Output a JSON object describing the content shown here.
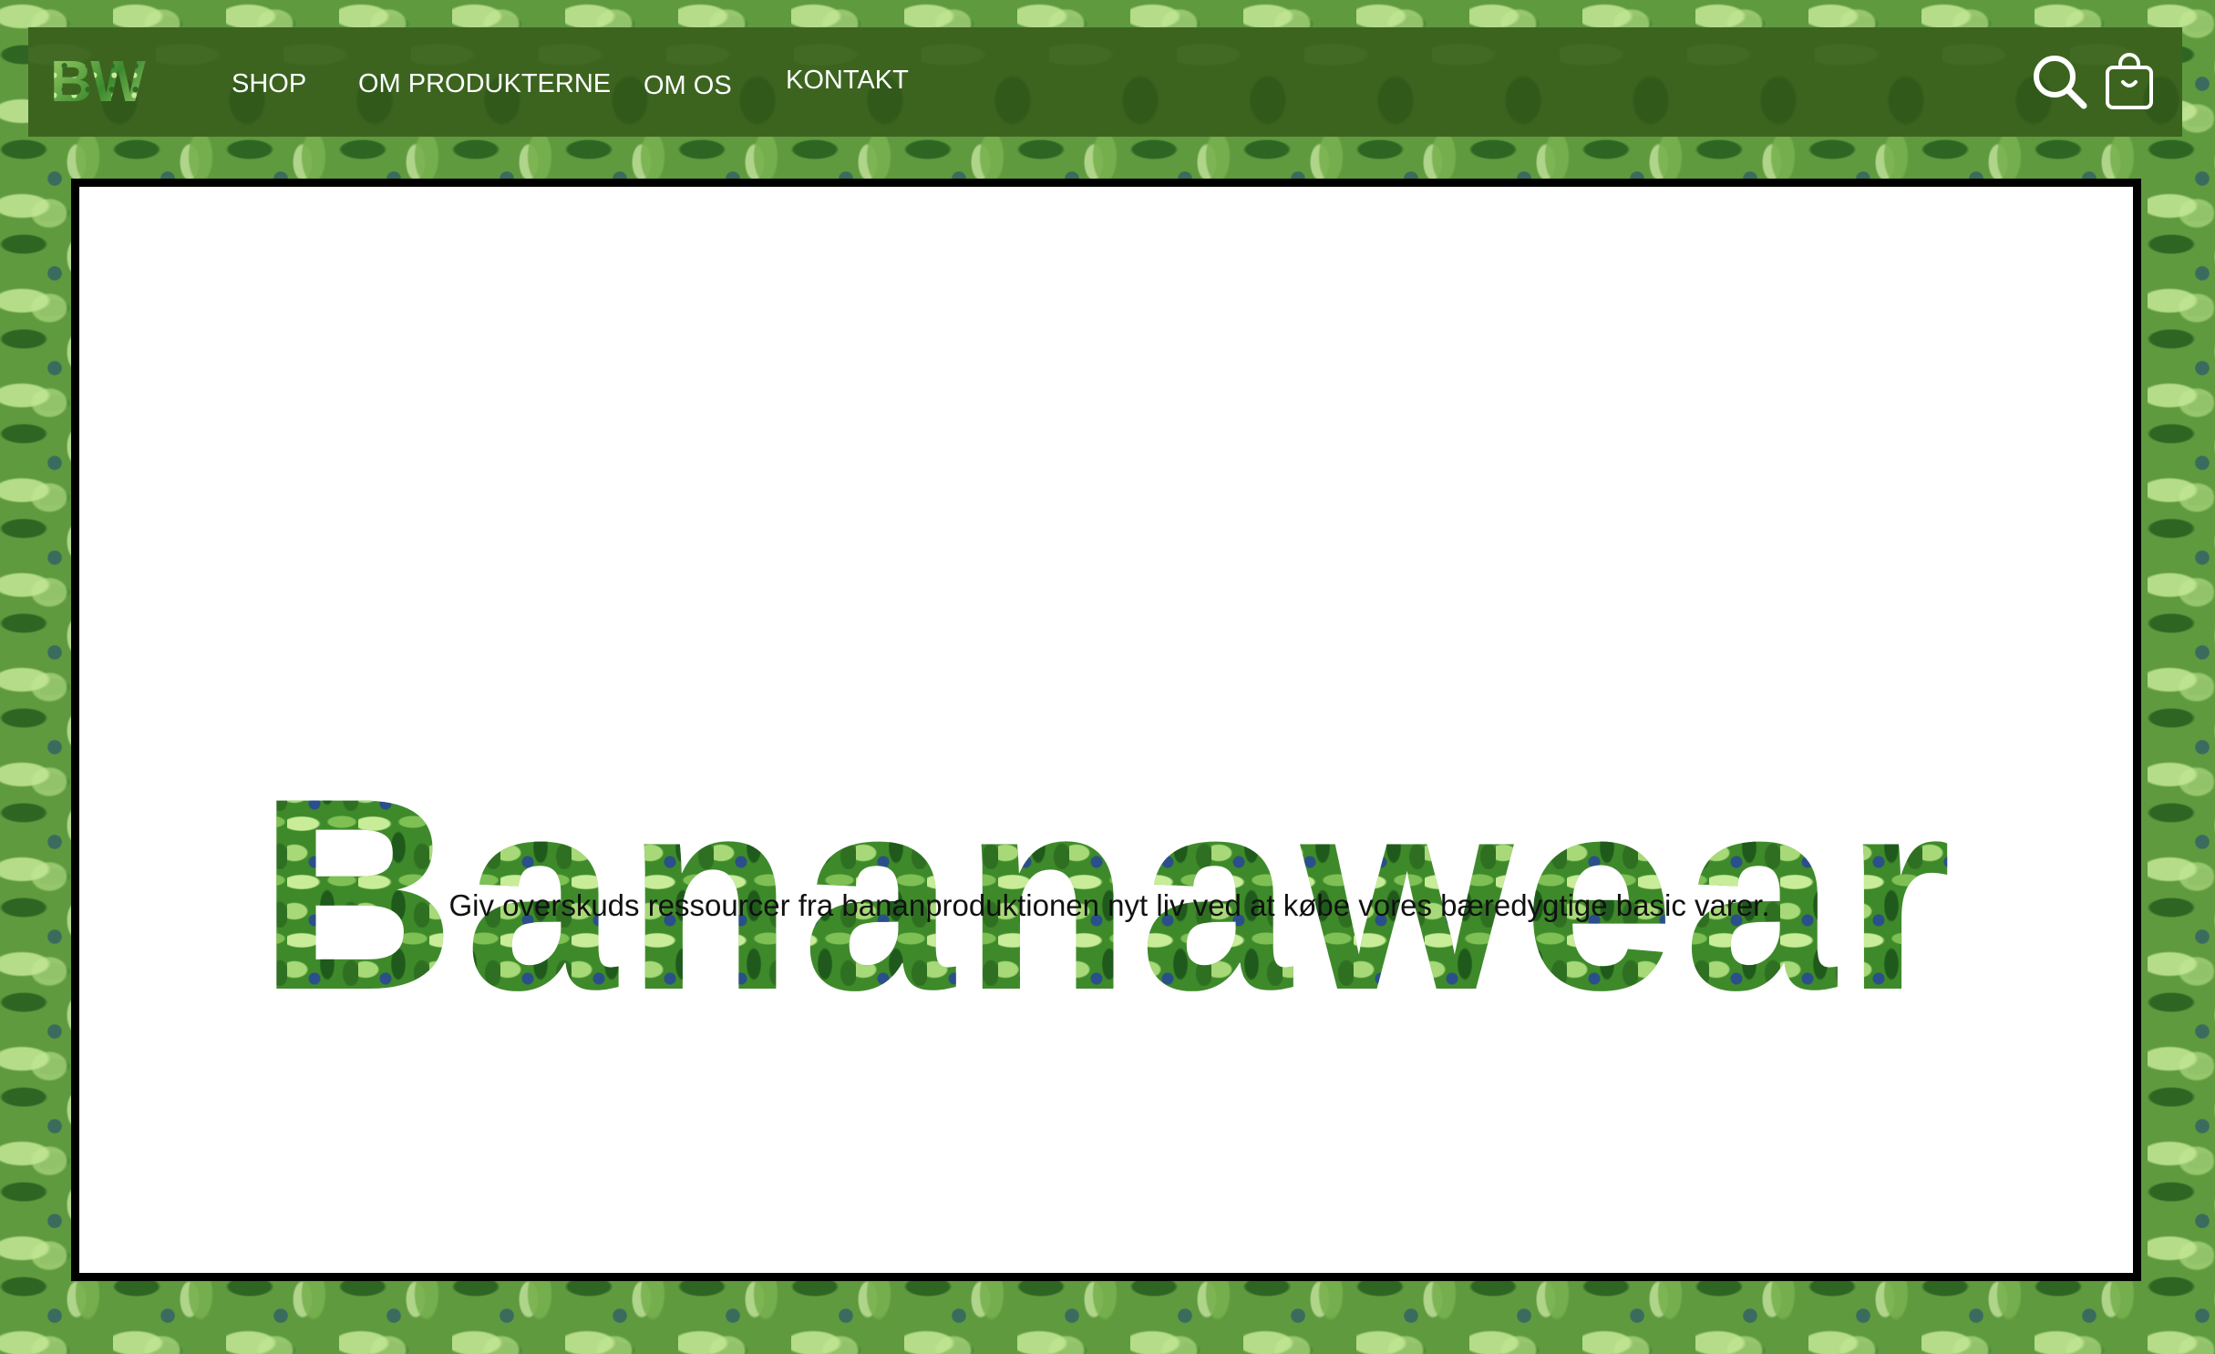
{
  "header": {
    "logo_text": "BW",
    "nav": [
      {
        "label": "SHOP"
      },
      {
        "label": "OM PRODUKTERNE"
      },
      {
        "label": "OM OS"
      },
      {
        "label": "KONTAKT"
      }
    ],
    "icons": {
      "search": "search-icon",
      "cart": "shopping-bag-icon"
    }
  },
  "hero": {
    "title": "Bananawear",
    "tagline": "Giv overskuds ressourcer fra bananproduktionen nyt liv ved at købe vores bæredygtige basic varer."
  },
  "colors": {
    "navbar_bg": "#3c641f",
    "nav_text": "#ffffff",
    "hero_bg": "#ffffff",
    "hero_border": "#000000",
    "tagline_text": "#111111",
    "leaf_green": "#3e8a2a"
  }
}
